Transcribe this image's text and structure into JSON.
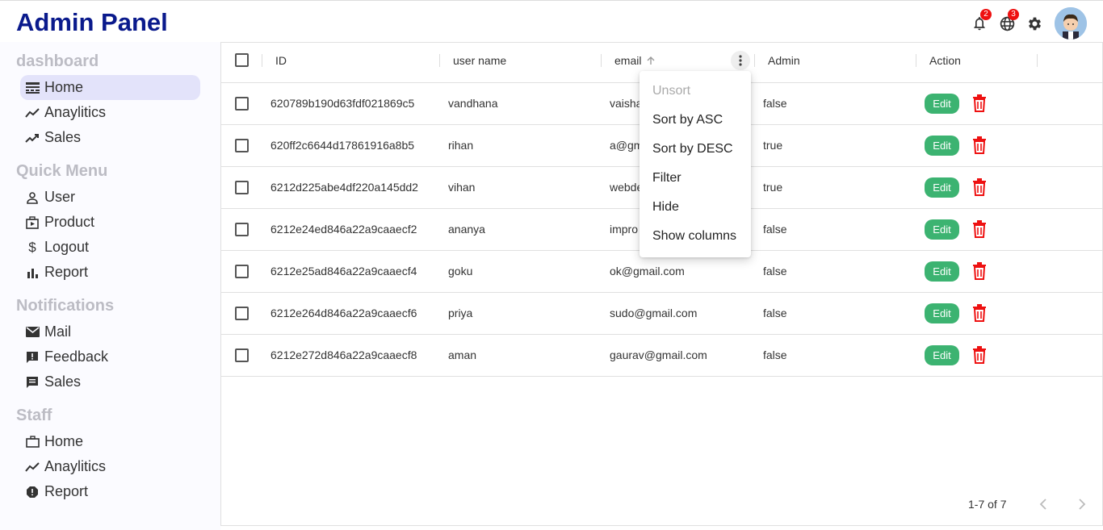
{
  "header": {
    "title": "Admin Panel",
    "notification_count": "2",
    "language_count": "3"
  },
  "sidebar": {
    "sections": [
      {
        "title": "dashboard",
        "items": [
          {
            "label": "Home",
            "icon": "home-line-icon",
            "active": true
          },
          {
            "label": "Anaylitics",
            "icon": "timeline-icon"
          },
          {
            "label": "Sales",
            "icon": "trending-up-icon"
          }
        ]
      },
      {
        "title": "Quick Menu",
        "items": [
          {
            "label": "User",
            "icon": "person-outline-icon"
          },
          {
            "label": "Product",
            "icon": "storefront-icon"
          },
          {
            "label": "Logout",
            "icon": "dollar-icon"
          },
          {
            "label": "Report",
            "icon": "bar-chart-icon"
          }
        ]
      },
      {
        "title": "Notifications",
        "items": [
          {
            "label": "Mail",
            "icon": "mail-icon"
          },
          {
            "label": "Feedback",
            "icon": "feedback-icon"
          },
          {
            "label": "Sales",
            "icon": "chat-icon"
          }
        ]
      },
      {
        "title": "Staff",
        "items": [
          {
            "label": "Home",
            "icon": "work-outline-icon"
          },
          {
            "label": "Anaylitics",
            "icon": "timeline-icon"
          },
          {
            "label": "Report",
            "icon": "report-icon"
          }
        ]
      }
    ]
  },
  "grid": {
    "columns": {
      "id": "ID",
      "username": "user name",
      "email": "email",
      "admin": "Admin",
      "action": "Action"
    },
    "edit_label": "Edit",
    "rows": [
      {
        "id": "620789b190d63fdf021869c5",
        "username": "vandhana",
        "email": "vaisha",
        "admin": "false"
      },
      {
        "id": "620ff2c6644d17861916a8b5",
        "username": "rihan",
        "email": "a@gm",
        "admin": "true"
      },
      {
        "id": "6212d225abe4df220a145dd2",
        "username": "vihan",
        "email": "webde",
        "admin": "true"
      },
      {
        "id": "6212e24ed846a22a9caaecf2",
        "username": "ananya",
        "email": "impro",
        "admin": "false"
      },
      {
        "id": "6212e25ad846a22a9caaecf4",
        "username": "goku",
        "email": "ok@gmail.com",
        "admin": "false"
      },
      {
        "id": "6212e264d846a22a9caaecf6",
        "username": "priya",
        "email": "sudo@gmail.com",
        "admin": "false"
      },
      {
        "id": "6212e272d846a22a9caaecf8",
        "username": "aman",
        "email": "gaurav@gmail.com",
        "admin": "false"
      }
    ],
    "column_menu": [
      "Unsort",
      "Sort by ASC",
      "Sort by DESC",
      "Filter",
      "Hide",
      "Show columns"
    ],
    "pagination": "1-7 of 7"
  },
  "colors": {
    "brand": "#0a1a8c",
    "edit": "#3cb371",
    "delete": "#e11",
    "active_bg": "#e3e3fa"
  }
}
